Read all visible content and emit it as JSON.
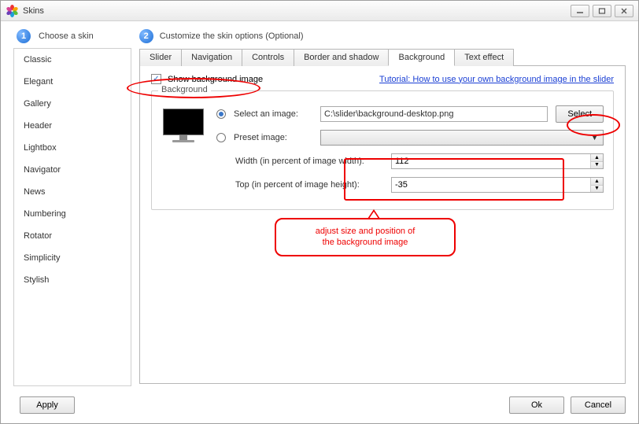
{
  "window": {
    "title": "Skins"
  },
  "steps": {
    "one_label": "Choose a skin",
    "two_label": "Customize the skin options (Optional)"
  },
  "sidebar": {
    "items": [
      "Classic",
      "Elegant",
      "Gallery",
      "Header",
      "Lightbox",
      "Navigator",
      "News",
      "Numbering",
      "Rotator",
      "Simplicity",
      "Stylish"
    ]
  },
  "tabs": {
    "items": [
      "Slider",
      "Navigation",
      "Controls",
      "Border and shadow",
      "Background",
      "Text effect"
    ],
    "active": "Background"
  },
  "bg": {
    "checkbox_label": "Show background image",
    "checkbox_checked": true,
    "tutorial_link": "Tutorial: How to use your own background image in the slider",
    "group_title": "Background",
    "radio_select_label": "Select an image:",
    "radio_preset_label": "Preset image:",
    "image_path": "C:\\slider\\background-desktop.png",
    "select_button": "Select",
    "width_label": "Width (in percent of image width):",
    "width_value": "112",
    "top_label": "Top (in percent of image height):",
    "top_value": "-35"
  },
  "annotation": {
    "callout": "adjust size and position of\nthe background image"
  },
  "footer": {
    "apply": "Apply",
    "ok": "Ok",
    "cancel": "Cancel"
  }
}
